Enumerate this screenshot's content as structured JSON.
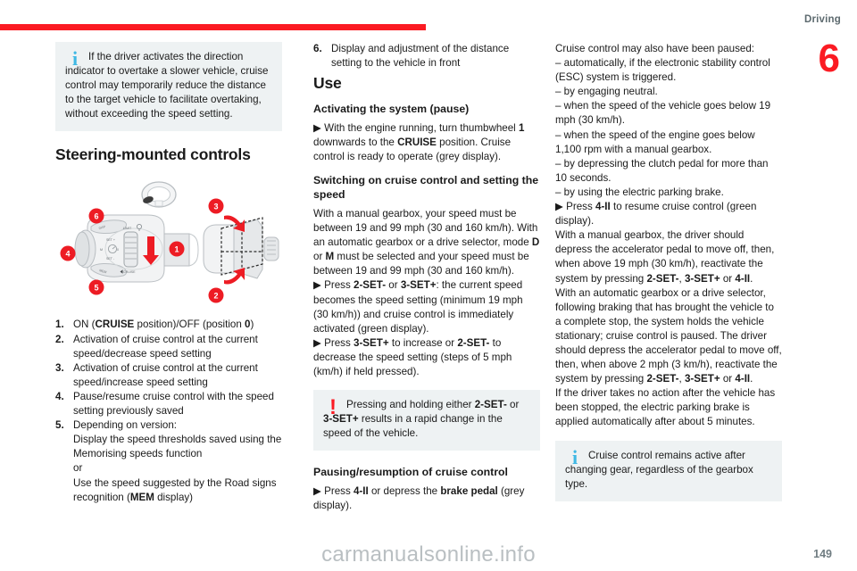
{
  "header": {
    "section": "Driving",
    "chapter_number": "6"
  },
  "footer": {
    "watermark": "carmanualsonline.info",
    "page_number": "149"
  },
  "column1": {
    "info_callout": {
      "icon": "info-icon",
      "line1": "If the driver activates the direction",
      "line2": "indicator to overtake a slower vehicle,",
      "rest": "cruise control may temporarily reduce the distance to the target vehicle to facilitate overtaking, without exceeding the speed setting."
    },
    "heading": "Steering-mounted controls",
    "illustration": {
      "name": "steering-mounted-cruise-control-stalk-diagram",
      "callout_markers": [
        "1",
        "2",
        "3",
        "4",
        "5",
        "6"
      ],
      "stalk_labels": [
        "LIMIT",
        "SET +",
        "SET -",
        "CRUISE",
        "0",
        "M",
        "GAP",
        "MEM"
      ]
    },
    "list": [
      {
        "num": "1.",
        "parts": [
          {
            "t": "ON (",
            "b": false
          },
          {
            "t": "CRUISE",
            "b": true
          },
          {
            "t": " position)/OFF (position ",
            "b": false
          },
          {
            "t": "0",
            "b": true
          },
          {
            "t": ")",
            "b": false
          }
        ]
      },
      {
        "num": "2.",
        "lines": [
          "Activation of cruise control at the current",
          "speed/decrease speed setting"
        ]
      },
      {
        "num": "3.",
        "lines": [
          "Activation of cruise control at the current",
          "speed/increase speed setting"
        ]
      },
      {
        "num": "4.",
        "lines": [
          "Pause/resume cruise control with the speed",
          "setting previously saved"
        ]
      },
      {
        "num": "5.",
        "lines": [
          "Depending on version:",
          "Display the speed thresholds saved using the",
          "Memorising speeds function",
          "or",
          "Use the speed suggested by the Road signs"
        ],
        "last_line_parts": [
          {
            "t": "recognition (",
            "b": false
          },
          {
            "t": "MEM",
            "b": true
          },
          {
            "t": " display)",
            "b": false
          }
        ]
      }
    ]
  },
  "column2": {
    "item6": {
      "num": "6.",
      "line1": "Display and adjustment of the distance",
      "line2": "setting to the vehicle in front"
    },
    "heading": "Use",
    "sub1": "Activating the system (pause)",
    "para1_parts": [
      {
        "t": "▶  With the engine running, turn thumbwheel ",
        "b": false
      },
      {
        "t": "1",
        "b": true
      },
      {
        "t": " downwards to the ",
        "b": false
      },
      {
        "t": "CRUISE",
        "b": true
      },
      {
        "t": " position. Cruise control is ready to operate (grey display).",
        "b": false
      }
    ],
    "sub2": "Switching on cruise control and setting the speed",
    "para2": "With a manual gearbox, your speed must be between 19 and 99 mph (30 and 160 km/h). With an automatic gearbox or a drive selector, mode D or M must be selected and your speed must be between 19 and 99 mph (30 and 160 km/h).",
    "para2_parts": [
      {
        "t": "With a manual gearbox, your speed must be between 19 and 99 mph (30 and 160 km/h). With an automatic gearbox or a drive selector, mode ",
        "b": false
      },
      {
        "t": "D",
        "b": true
      },
      {
        "t": " or ",
        "b": false
      },
      {
        "t": "M",
        "b": true
      },
      {
        "t": " must be selected and your speed must be between 19 and 99 mph (30 and 160 km/h).",
        "b": false
      }
    ],
    "para3_parts": [
      {
        "t": "▶  Press ",
        "b": false
      },
      {
        "t": "2-SET-",
        "b": true
      },
      {
        "t": " or  ",
        "b": false
      },
      {
        "t": "3-SET+",
        "b": true
      },
      {
        "t": ": the current speed becomes the speed setting (minimum 19 mph (30 km/h)) and cruise control is immediately activated (green display).",
        "b": false
      }
    ],
    "para4_parts": [
      {
        "t": "▶  Press ",
        "b": false
      },
      {
        "t": "3-SET+",
        "b": true
      },
      {
        "t": " to increase or ",
        "b": false
      },
      {
        "t": "2-SET-",
        "b": true
      },
      {
        "t": " to decrease the speed setting (steps of 5 mph (km/h) if held pressed).",
        "b": false
      }
    ],
    "warn_callout": {
      "icon": "warning-icon",
      "line1_parts": [
        {
          "t": "Pressing and holding either ",
          "b": false
        },
        {
          "t": "2-SET-",
          "b": true
        },
        {
          "t": " or",
          "b": false
        }
      ],
      "line2_parts": [
        {
          "t": "3-SET+",
          "b": true
        },
        {
          "t": " results in a rapid change in the",
          "b": false
        }
      ],
      "line3": "speed of the vehicle."
    },
    "sub3": "Pausing/resumption of cruise control",
    "para5_parts": [
      {
        "t": "▶  Press ",
        "b": false
      },
      {
        "t": "4-II",
        "b": true
      },
      {
        "t": " or depress the ",
        "b": false
      },
      {
        "t": "brake pedal",
        "b": true
      },
      {
        "t": " (grey display).",
        "b": false
      }
    ]
  },
  "column3": {
    "intro": "Cruise control may also have been paused:",
    "dashes": [
      "–  automatically, if the electronic stability control (ESC) system is triggered.",
      "–  by engaging neutral.",
      "–  when the speed of the vehicle goes below 19 mph (30 km/h).",
      "–  when the speed of the engine goes below 1,100 rpm with a manual gearbox.",
      "–  by depressing the clutch pedal for more than 10 seconds.",
      "–  by using the electric parking brake."
    ],
    "para1_parts": [
      {
        "t": "▶  Press ",
        "b": false
      },
      {
        "t": "4-II",
        "b": true
      },
      {
        "t": " to resume cruise control (green display).",
        "b": false
      }
    ],
    "para2_parts": [
      {
        "t": "With a manual gearbox, the driver should depress the accelerator pedal to move off, then, when above 19 mph (30 km/h), reactivate the system by pressing ",
        "b": false
      },
      {
        "t": "2-SET-",
        "b": true
      },
      {
        "t": ", ",
        "b": false
      },
      {
        "t": "3-SET+",
        "b": true
      },
      {
        "t": " or ",
        "b": false
      },
      {
        "t": "4-II",
        "b": true
      },
      {
        "t": ".",
        "b": false
      }
    ],
    "para3_parts": [
      {
        "t": "With an automatic gearbox or a drive selector, following braking that has brought the vehicle to a complete stop, the system holds the vehicle stationary; cruise control is paused. The driver should depress the accelerator pedal to move off, then, when above 2 mph (3 km/h), reactivate the system by pressing ",
        "b": false
      },
      {
        "t": "2-SET-",
        "b": true
      },
      {
        "t": ", ",
        "b": false
      },
      {
        "t": "3-SET+",
        "b": true
      },
      {
        "t": " or ",
        "b": false
      },
      {
        "t": "4-II",
        "b": true
      },
      {
        "t": ".",
        "b": false
      }
    ],
    "para4": "If the driver takes no action after the vehicle has been stopped, the electric parking brake is applied automatically after about 5 minutes.",
    "info_callout": {
      "icon": "info-icon",
      "line1": "Cruise control remains active after",
      "line2": "changing gear, regardless of the gearbox",
      "line3": "type."
    }
  },
  "colors": {
    "accent_red": "#fb1b23",
    "info_blue": "#3fb8e4",
    "callout_bg": "#eef2f3",
    "header_grey": "#5d6a6f"
  }
}
